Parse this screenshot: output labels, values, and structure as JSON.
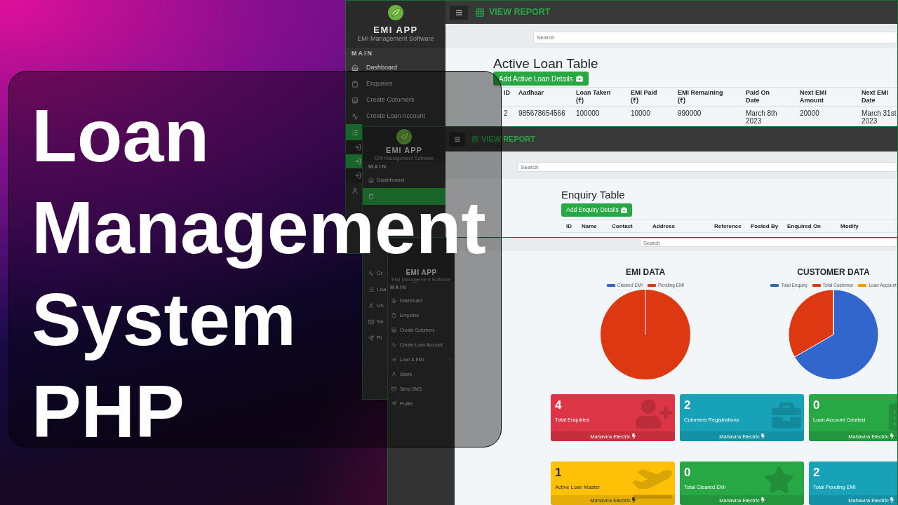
{
  "title_lines": [
    "Loan",
    "Management",
    "System",
    "PHP"
  ],
  "windows": [
    {
      "kind": "table",
      "app_name": "EMI APP",
      "app_tagline": "EMI Management Software",
      "section": "MAIN",
      "sidebar": [
        {
          "kind": "link",
          "label": "Dashboard",
          "selected": false
        },
        {
          "kind": "link",
          "label": "Enquiries",
          "selected": false
        },
        {
          "kind": "link",
          "label": "Create Cutomers",
          "selected": false
        },
        {
          "kind": "link",
          "label": "Create Loan Account",
          "selected": false
        },
        {
          "kind": "link",
          "selected": true
        },
        {
          "kind": "sub",
          "selected": false
        },
        {
          "kind": "sub",
          "selected": true
        },
        {
          "kind": "sub",
          "selected": false
        },
        {
          "kind": "link",
          "selected": false
        }
      ],
      "topbar": {
        "title": "VIEW REPORT"
      },
      "search": {
        "placeholder": "Search"
      },
      "heading": "Active Loan Table",
      "button": "Add Active Loan Details",
      "table": {
        "columns": [
          "ID",
          "Aadhaar",
          "Loan Taken (₹)",
          "EMI Paid (₹)",
          "EMI Remaining (₹)",
          "Paid On Date",
          "Next EMI Amount",
          "Next EMI Date"
        ],
        "rows": [
          [
            "2",
            "985678654566",
            "100000",
            "10000",
            "990000",
            "March 8th 2023",
            "20000",
            "March 31st 2023"
          ]
        ]
      }
    },
    {
      "kind": "table",
      "app_name": "EMI APP",
      "app_tagline": "EMI Management Software",
      "section": "MAIN",
      "sidebar": [
        {
          "kind": "link",
          "label": "Dashboard",
          "selected": false
        },
        {
          "kind": "link",
          "selected": true
        },
        {
          "kind": "link",
          "label": "Cr",
          "selected": false
        },
        {
          "kind": "link",
          "label": "Loa",
          "selected": false
        },
        {
          "kind": "link",
          "label": "Us",
          "selected": false
        },
        {
          "kind": "link",
          "label": "Se",
          "selected": false
        },
        {
          "kind": "link",
          "label": "Pr",
          "selected": false
        }
      ],
      "topbar": {
        "title": "VIEW REPORT"
      },
      "search": {
        "placeholder": "Search"
      },
      "heading": "Enquiry Table",
      "button": "Add Enquiry Details",
      "table": {
        "columns": [
          "ID",
          "Name",
          "Contact",
          "Address",
          "Reference",
          "Posted By",
          "Enquired On",
          "Modify"
        ]
      }
    },
    {
      "kind": "dashboard",
      "app_name": "EMI APP",
      "app_tagline": "EMI Management Software",
      "section": "MAIN",
      "sidebar": [
        {
          "kind": "link",
          "label": "Dashboard",
          "selected": false
        },
        {
          "kind": "link",
          "label": "Enquiries",
          "selected": false
        },
        {
          "kind": "link",
          "label": "Create Cutomers",
          "selected": false
        },
        {
          "kind": "link",
          "label": "Create Loan Account",
          "selected": false
        },
        {
          "kind": "link",
          "label": "Loan & EMI",
          "selected": false,
          "expanded": false
        },
        {
          "kind": "link",
          "label": "Users",
          "selected": false
        },
        {
          "kind": "link",
          "label": "Send SMS",
          "selected": false
        },
        {
          "kind": "link",
          "label": "Profile",
          "selected": false
        }
      ],
      "search": {
        "placeholder": "Search"
      },
      "charts": [
        {
          "title": "EMI DATA",
          "legend": [
            {
              "label": "Cleared EMI",
              "color": "#3366cc"
            },
            {
              "label": "Pending EMI",
              "color": "#dc3912"
            }
          ]
        },
        {
          "title": "CUSTOMER DATA",
          "legend": [
            {
              "label": "Total Enquiry",
              "color": "#3366cc"
            },
            {
              "label": "Total Customer",
              "color": "#dc3912"
            },
            {
              "label": "Loan Account",
              "color": "#ff9900"
            }
          ]
        }
      ],
      "cards": [
        {
          "value": "4",
          "label": "Total Enquiries",
          "footer": "Mahavira Electric",
          "color": "#dc3545"
        },
        {
          "value": "2",
          "label": "Cutomers Registrations",
          "footer": "Mahavira Electric",
          "color": "#17a2b8"
        },
        {
          "value": "0",
          "label": "Loan Account Created",
          "footer": "Mahavira Electric",
          "color": "#28a745"
        },
        {
          "value": "1",
          "label": "Active Loan Master",
          "footer": "Mahavira Electric",
          "color": "#ffc107"
        },
        {
          "value": "0",
          "label": "Total Cleared EMI",
          "footer": "Mahavira Electric",
          "color": "#28a745"
        },
        {
          "value": "2",
          "label": "Total Pending EMI",
          "footer": "Mahavira Electric",
          "color": "#17a2b8"
        }
      ]
    }
  ]
}
